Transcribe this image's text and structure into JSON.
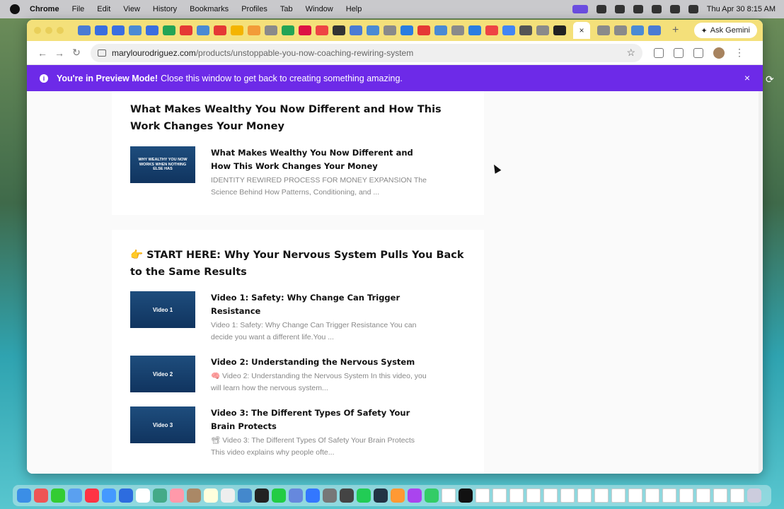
{
  "menubar": {
    "items": [
      "Chrome",
      "File",
      "Edit",
      "View",
      "History",
      "Bookmarks",
      "Profiles",
      "Tab",
      "Window",
      "Help"
    ],
    "clock": "Thu Apr 30  8:15 AM"
  },
  "browser": {
    "gemini_label": "Ask Gemini",
    "gemini_overflow": "mini",
    "tab_close": "×",
    "new_tab": "+",
    "url_host": "marylourodriguez.com",
    "url_path": "/products/unstoppable-you-now-coaching-rewiring-system"
  },
  "banner": {
    "strong": "You're in Preview Mode!",
    "text": "Close this window to get back to creating something amazing.",
    "close": "×"
  },
  "sections": [
    {
      "title": "What Makes Wealthy You Now Different and How This Work Changes Your Money",
      "lessons": [
        {
          "thumb": "WHY WEALTHY YOU NOW WORKS WHEN NOTHING ELSE HAS",
          "title": "What Makes Wealthy You Now Different and How This Work Changes Your Money",
          "desc": "IDENTITY REWIRED PROCESS FOR MONEY EXPANSION  The Science Behind How Patterns, Conditioning, and ..."
        }
      ]
    },
    {
      "title": "👉 START HERE: Why Your Nervous System Pulls You Back to the Same Results",
      "lessons": [
        {
          "thumb": "Video 1",
          "title": "Video 1: Safety: Why Change Can Trigger Resistance",
          "desc": " Video 1: Safety: Why Change Can Trigger Resistance You can decide you want a different life.You ..."
        },
        {
          "thumb": "Video 2",
          "title": "Video 2: Understanding the Nervous System",
          "desc": "🧠 Video 2: Understanding the Nervous System In this video, you will learn how the nervous system..."
        },
        {
          "thumb": "Video 3",
          "title": "Video 3: The Different Types Of Safety Your Brain Protects",
          "desc": "📽 Video 3: The Different Types Of Safety Your Brain Protects This video explains why people ofte..."
        }
      ]
    }
  ]
}
